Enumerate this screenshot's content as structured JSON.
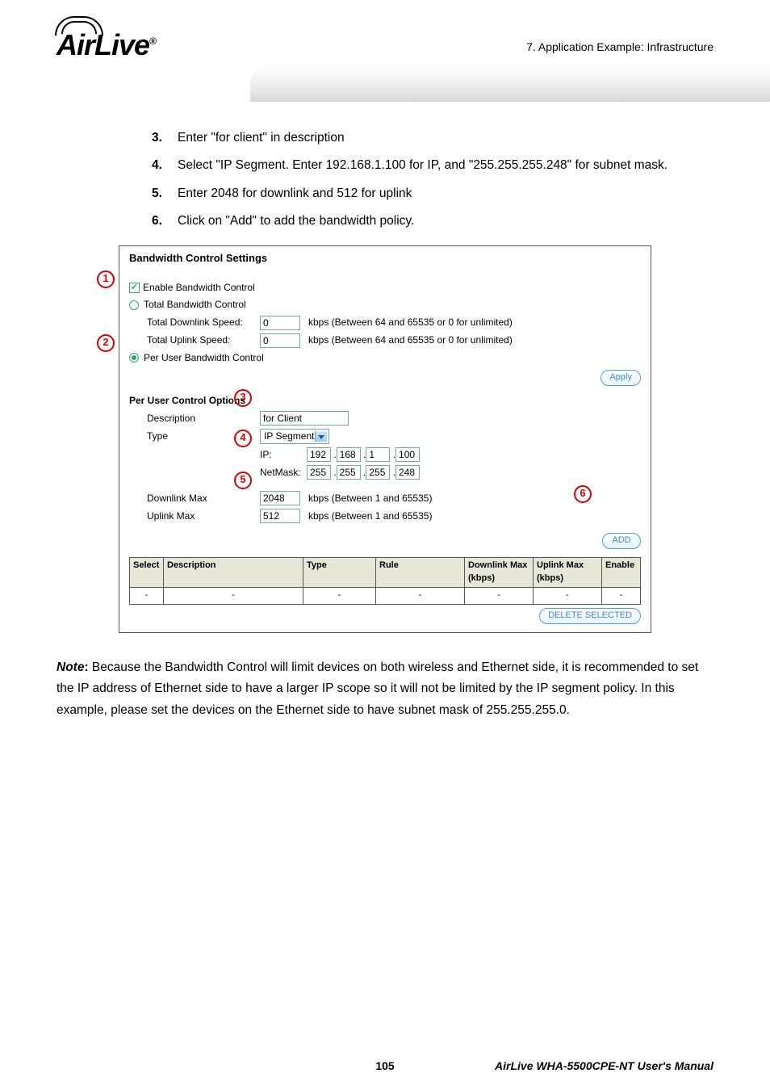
{
  "header": {
    "chapter": "7.  Application  Example:  Infrastructure",
    "logo_text": "AirLive",
    "logo_reg": "®"
  },
  "steps": [
    {
      "num": "3.",
      "text": "Enter \"for client\" in description"
    },
    {
      "num": "4.",
      "text": "Select \"IP Segment.   Enter 192.168.1.100 for IP, and \"255.255.255.248\" for subnet mask."
    },
    {
      "num": "5.",
      "text": "Enter 2048 for downlink and 512 for uplink"
    },
    {
      "num": "6.",
      "text": "Click on \"Add\" to add the bandwidth policy."
    }
  ],
  "screenshot": {
    "title": "Bandwidth Control Settings",
    "enable_label": "Enable Bandwidth Control",
    "total_label": "Total Bandwidth Control",
    "total_down_label": "Total Downlink Speed:",
    "total_down_value": "0",
    "total_up_label": "Total Uplink Speed:",
    "total_up_value": "0",
    "kbps_hint": "kbps (Between 64 and 65535 or 0 for unlimited)",
    "peruser_label": "Per User Bandwidth Control",
    "apply_btn": "Apply",
    "section2_title": "Per User Control Options",
    "desc_label": "Description",
    "desc_value": "for Client",
    "type_label": "Type",
    "type_value": "IP Segment",
    "ip_label": "IP:",
    "ip": [
      "192",
      "168",
      "1",
      "100"
    ],
    "mask_label": "NetMask:",
    "mask": [
      "255",
      "255",
      "255",
      "248"
    ],
    "down_label": "Downlink Max",
    "down_value": "2048",
    "up_label": "Uplink Max",
    "up_value": "512",
    "kbps_hint2": "kbps (Between 1 and 65535)",
    "add_btn": "ADD",
    "table_headers": [
      "Select",
      "Description",
      "Type",
      "Rule",
      "Downlink Max (kbps)",
      "Uplink Max (kbps)",
      "Enable"
    ],
    "table_row": [
      "-",
      "-",
      "-",
      "-",
      "-",
      "-",
      "-"
    ],
    "delete_btn": "DELETE SELECTED",
    "annotations": [
      "1",
      "2",
      "3",
      "4",
      "5",
      "6"
    ]
  },
  "note": {
    "label": "Note",
    "colon": ":",
    "text": "   Because the Bandwidth Control will limit devices on both wireless and Ethernet side, it is recommended to set the IP address of Ethernet side to have a larger IP scope so it will not be limited by the IP segment policy.    In this example, please set the devices on the Ethernet side to have subnet mask of 255.255.255.0."
  },
  "footer": {
    "page": "105",
    "manual": "AirLive  WHA-5500CPE-NT  User's  Manual"
  }
}
